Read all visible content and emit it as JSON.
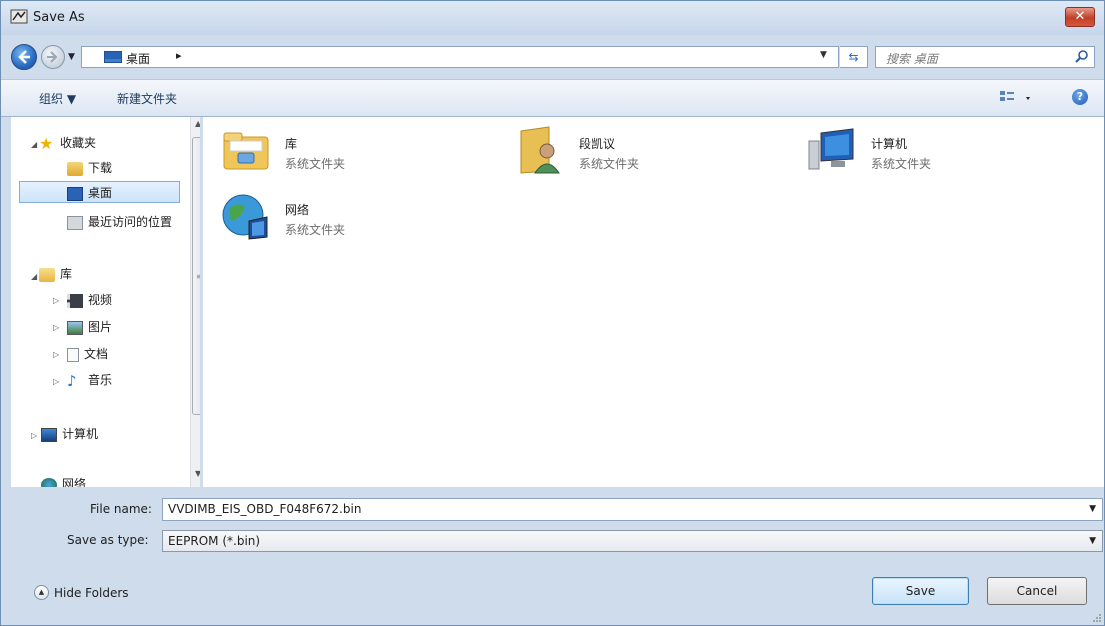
{
  "window": {
    "title": "Save As",
    "close_icon": "close-icon"
  },
  "address": {
    "segments": [
      "桌面"
    ],
    "search_placeholder": "搜索 桌面"
  },
  "toolbar": {
    "organize": "组织 ▼",
    "new_folder": "新建文件夹"
  },
  "nav": {
    "favorites": "收藏夹",
    "downloads": "下载",
    "desktop": "桌面",
    "recent": "最近访问的位置",
    "libraries": "库",
    "videos": "视频",
    "pictures": "图片",
    "documents": "文档",
    "music": "音乐",
    "computer": "计算机",
    "network": "网络"
  },
  "items": [
    {
      "name": "库",
      "type": "系统文件夹",
      "icon": "library-folder-icon"
    },
    {
      "name": "段凯议",
      "type": "系统文件夹",
      "icon": "user-folder-icon"
    },
    {
      "name": "计算机",
      "type": "系统文件夹",
      "icon": "computer-icon"
    },
    {
      "name": "网络",
      "type": "系统文件夹",
      "icon": "network-icon"
    }
  ],
  "form": {
    "file_name_label": "File name:",
    "file_name_value": "VVDIMB_EIS_OBD_F048F672.bin",
    "save_type_label": "Save as type:",
    "save_type_value": "EEPROM (*.bin)"
  },
  "footer": {
    "hide_folders": "Hide Folders",
    "save": "Save",
    "cancel": "Cancel"
  }
}
